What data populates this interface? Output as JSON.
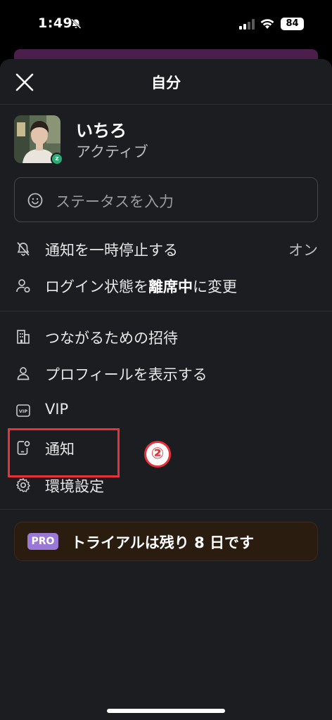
{
  "status_bar": {
    "time": "1:49",
    "battery": "84"
  },
  "header": {
    "title": "自分"
  },
  "profile": {
    "name": "いちろ",
    "presence": "アクティブ",
    "presence_badge": "z"
  },
  "status_input": {
    "placeholder": "ステータスを入力"
  },
  "menu": {
    "pause": {
      "label": "通知を一時停止する",
      "value": "オン",
      "icon": "bell-off-icon"
    },
    "away": {
      "prefix": "ログイン状態を",
      "bold": "離席中",
      "suffix": "に変更",
      "icon": "person-status-icon"
    },
    "invite": {
      "label": "つながるための招待",
      "icon": "building-icon"
    },
    "profile": {
      "label": "プロフィールを表示する",
      "icon": "person-icon"
    },
    "vip": {
      "label": "VIP",
      "icon": "vip-icon"
    },
    "notifications": {
      "label": "通知",
      "icon": "phone-notification-icon"
    },
    "preferences": {
      "label": "環境設定",
      "icon": "gear-icon"
    }
  },
  "annotation": {
    "number": "②"
  },
  "trial": {
    "badge": "PRO",
    "text": "トライアルは残り 8 日です"
  },
  "colors": {
    "sheet_bg": "#1b1d21",
    "highlight": "#e8323b",
    "presence": "#2bac76",
    "pro_badge": "#9b77d6",
    "trial_bg": "#2b1c10"
  }
}
